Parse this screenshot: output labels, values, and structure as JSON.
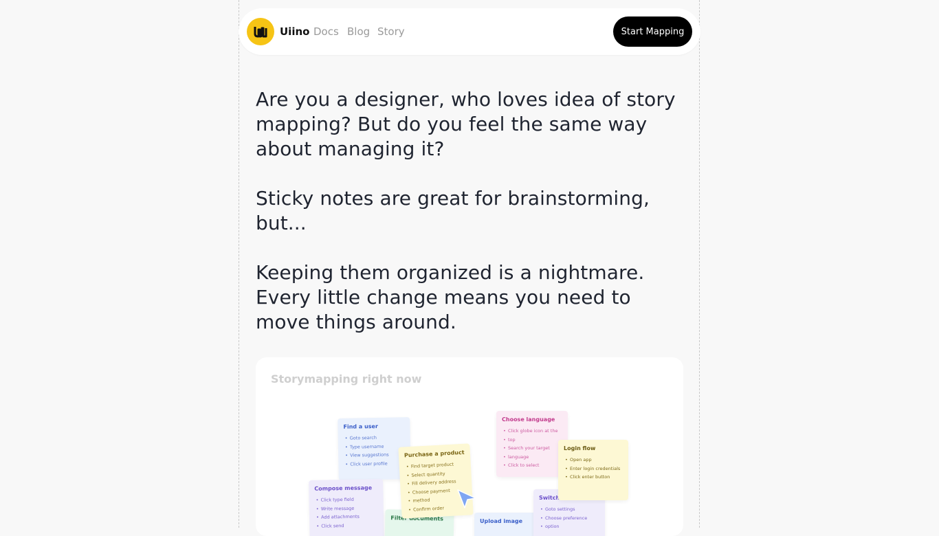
{
  "nav": {
    "brand": "Uiino",
    "links": [
      "Docs",
      "Blog",
      "Story"
    ],
    "cta": "Start Mapping"
  },
  "story": {
    "paragraphs": [
      "Are you a designer, who loves idea of story mapping? But do you feel the same way about managing it?",
      "Sticky notes are great for brainstorming, but...",
      "Keeping them organized is a nightmare. Every little change means you need to move things around."
    ]
  },
  "card": {
    "title": "Storymapping right now",
    "notes": {
      "find_user": {
        "title": "Find a user",
        "items": [
          "Goto search",
          "Type username",
          "View suggestions",
          "Click user profile"
        ]
      },
      "purchase": {
        "title": "Purchase a product",
        "items": [
          "Find target product",
          "Select quantity",
          "Fill delivery address",
          "Choose payment",
          "method",
          "Confirm order"
        ]
      },
      "language": {
        "title": "Choose language",
        "items": [
          "Click globe icon at the",
          "top",
          "Search your target",
          "language",
          "Click to select"
        ]
      },
      "login": {
        "title": "Login flow",
        "items": [
          "Open app",
          "Enter login credentials",
          "Click enter button"
        ]
      },
      "compose": {
        "title": "Compose message",
        "items": [
          "Click type field",
          "Write message",
          "Add attachments",
          "Click send"
        ]
      },
      "switch": {
        "title": "Switch",
        "items": [
          "Goto settings",
          "Choose preference",
          "option"
        ]
      },
      "filter": {
        "title": "Filter documents"
      },
      "upload": {
        "title": "Upload image"
      }
    }
  },
  "colors": {
    "logo": "#f6c415",
    "cta_bg": "#000000",
    "blue_note": "#eaf1fd",
    "yellow_note": "#fdf8d4",
    "pink_note": "#fbeaf4",
    "lavender_note": "#efecfb",
    "green_note": "#e5f7ec"
  }
}
